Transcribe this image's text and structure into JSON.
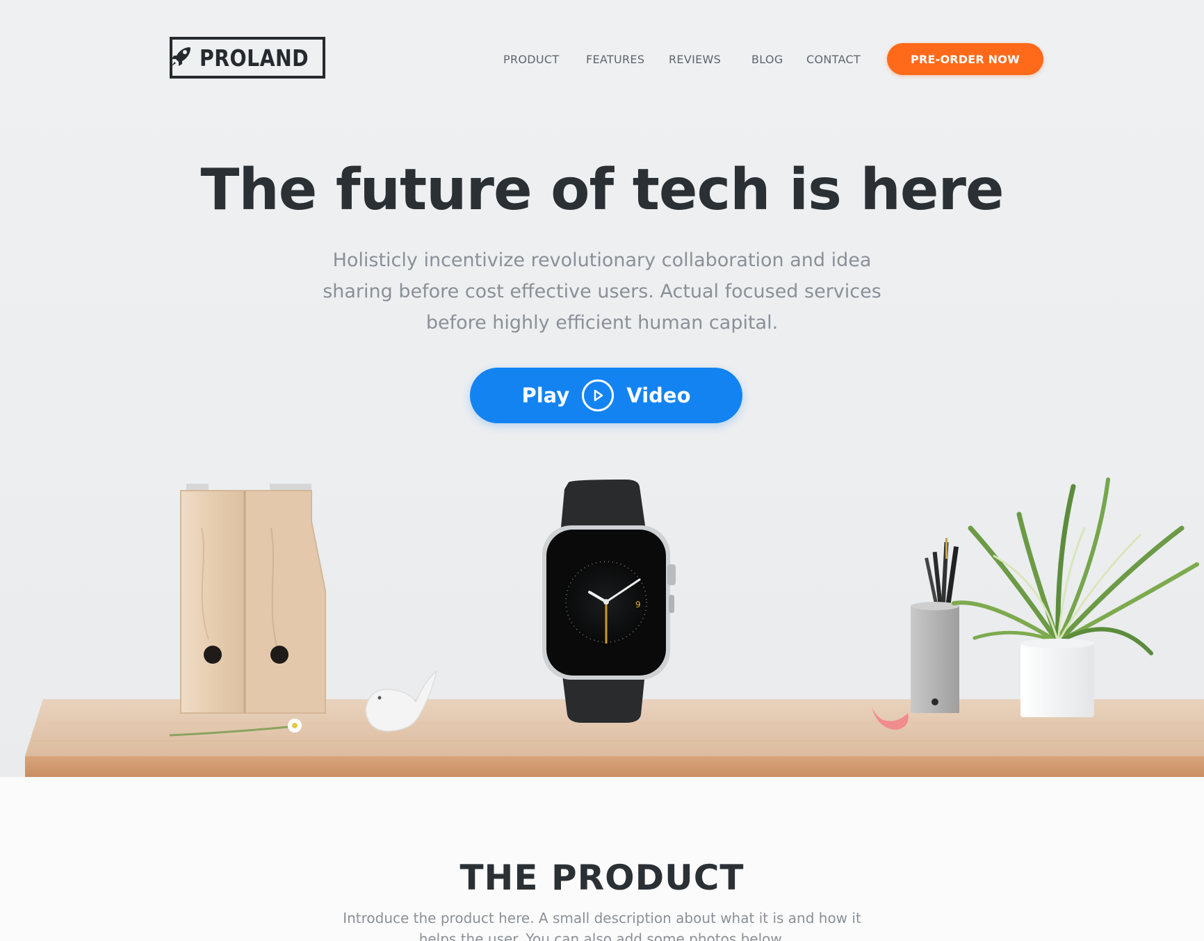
{
  "header": {
    "brand": "PROLAND",
    "nav": [
      "PRODUCT",
      "FEATURES",
      "REVIEWS",
      "BLOG",
      "CONTACT"
    ],
    "cta_label": "PRE-ORDER NOW"
  },
  "hero": {
    "headline": "The future of tech is here",
    "subtext": "Holisticly incentivize revolutionary collaboration and idea sharing before cost effective users. Actual focused services before highly efficient human capital.",
    "play_label": "Play",
    "video_label": "Video",
    "watch_digit": "9"
  },
  "product": {
    "title": "THE PRODUCT",
    "description": "Introduce the product here. A small description about what it is and how it helps the user. You can also add some photos below."
  },
  "colors": {
    "accent_orange": "#ff6a1a",
    "accent_blue": "#1383f2",
    "text_dark": "#2b3035",
    "text_muted": "#8a9097"
  },
  "icons": [
    "rocket-icon",
    "play-icon"
  ]
}
